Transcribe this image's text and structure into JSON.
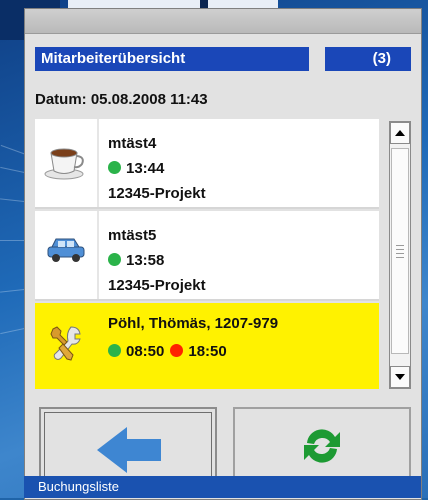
{
  "header": {
    "title": "Mitarbeiterübersicht",
    "count": "(3)"
  },
  "date_label": "Datum: 05.08.2008 11:43",
  "employees": [
    {
      "icon": "coffee-cup-icon",
      "name": "mtäst4",
      "time_in": "13:44",
      "project": "12345-Projekt"
    },
    {
      "icon": "car-icon",
      "name": "mtäst5",
      "time_in": "13:58",
      "project": "12345-Projekt"
    },
    {
      "icon": "tools-icon",
      "name": "Pöhl, Thömäs, 1207-979",
      "time_in": "08:50",
      "time_out": "18:50",
      "selected": true
    }
  ],
  "buttons": {
    "back": "arrow-left-icon",
    "refresh": "refresh-icon"
  },
  "status_bar": "Buchungsliste",
  "colors": {
    "header": "#1a47b8",
    "selected": "#fff200",
    "status_green": "#2bb34a",
    "status_red": "#ff2200"
  }
}
